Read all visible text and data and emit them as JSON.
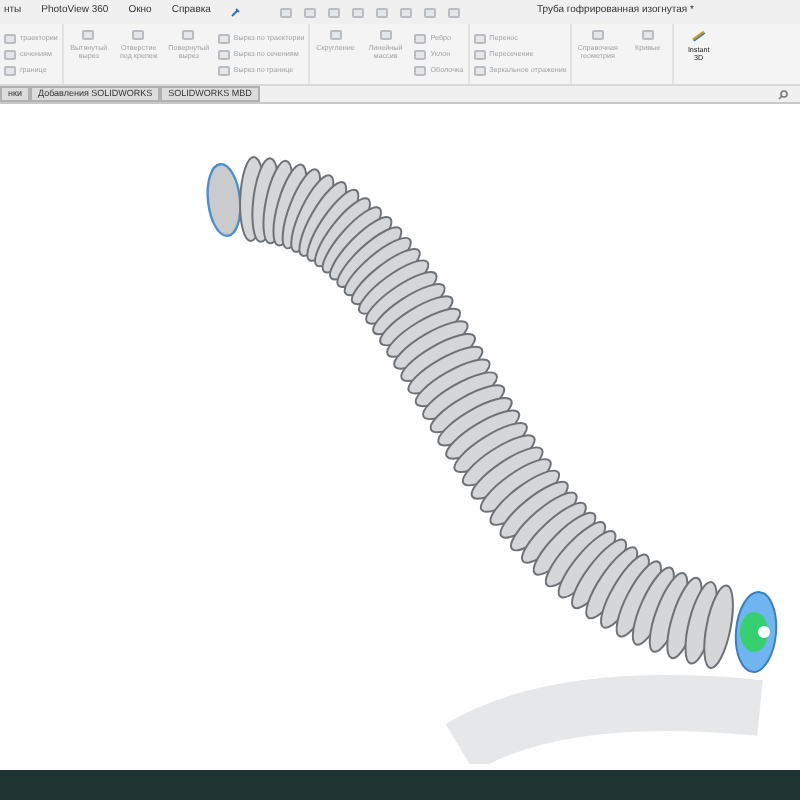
{
  "menu": [
    "нты",
    "PhotoView 360",
    "Окно",
    "Справка"
  ],
  "window": {
    "title": "Труба гофрированная изогнутая *"
  },
  "ribbon": [
    {
      "kind": "list",
      "items": [
        "траектории",
        "сечениям",
        "границе"
      ]
    },
    {
      "kind": "big",
      "label": "Вытянутый вырез"
    },
    {
      "kind": "big",
      "label": "Отверстие под крепеж"
    },
    {
      "kind": "big",
      "label": "Повернутый вырез"
    },
    {
      "kind": "list",
      "items": [
        "Вырез по траектории",
        "Вырез по сечениям",
        "Вырез по границе"
      ]
    },
    {
      "kind": "big",
      "label": "Скругление"
    },
    {
      "kind": "big",
      "label": "Линейный массив"
    },
    {
      "kind": "list",
      "items": [
        "Ребро",
        "Уклон",
        "Оболочка"
      ]
    },
    {
      "kind": "list",
      "items": [
        "Перенос",
        "Пересечение",
        "Зеркальное отражение"
      ]
    },
    {
      "kind": "big",
      "label": "Справочная геометрия"
    },
    {
      "kind": "big",
      "label": "Кривые"
    },
    {
      "kind": "active",
      "label": "Instant 3D"
    }
  ],
  "tabs": [
    {
      "label": "нки",
      "selected": false
    },
    {
      "label": "Добавления SOLIDWORKS",
      "selected": false
    },
    {
      "label": "SOLIDWORKS MBD",
      "selected": false
    }
  ]
}
